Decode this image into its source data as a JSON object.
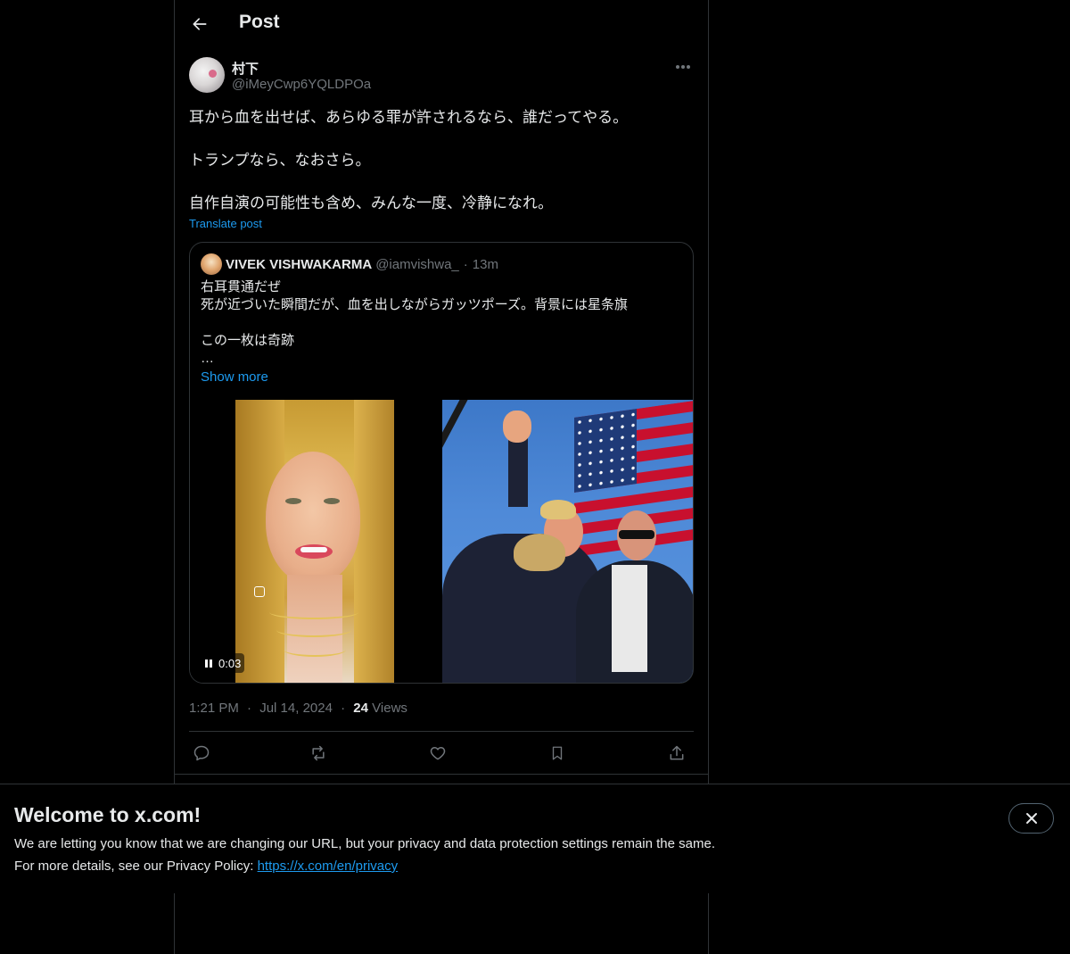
{
  "header": {
    "title": "Post"
  },
  "post": {
    "author_name": "村下",
    "author_handle": "@iMeyCwp6YQLDPOa",
    "lines": [
      "耳から血を出せば、あらゆる罪が許されるなら、誰だってやる。",
      "",
      "トランプなら、なおさら。",
      "",
      "自作自演の可能性も含め、みんな一度、冷静になれ。"
    ],
    "translate_label": "Translate post",
    "time": "1:21 PM",
    "date": "Jul 14, 2024",
    "views_count": "24",
    "views_label": "Views",
    "separator": "·"
  },
  "quote": {
    "name": "VIVEK VISHWAKARMA",
    "handle": "@iamvishwa_",
    "separator": "·",
    "time": "13m",
    "lines": [
      "右耳貫通だぜ",
      "死が近づいた瞬間だが、血を出しながらガッツポーズ。背景には星条旗",
      "",
      "この一枚は奇跡",
      "…"
    ],
    "show_more": "Show more",
    "video_time": "0:03"
  },
  "banner": {
    "title": "Welcome to x.com!",
    "line1": "We are letting you know that we are changing our URL, but your privacy and data protection settings remain the same.",
    "line2_prefix": "For more details, see our Privacy Policy: ",
    "link": "https://x.com/en/privacy"
  },
  "icons": {
    "back": "arrow-left-icon",
    "more": "more-horizontal-icon",
    "reply": "reply-icon",
    "repost": "repost-icon",
    "like": "heart-icon",
    "bookmark": "bookmark-icon",
    "share": "share-icon",
    "close": "close-icon",
    "pause": "pause-icon"
  },
  "colors": {
    "background": "#000000",
    "text": "#e7e9ea",
    "muted": "#71767b",
    "accent": "#1d9bf0",
    "border": "#2f3336"
  }
}
